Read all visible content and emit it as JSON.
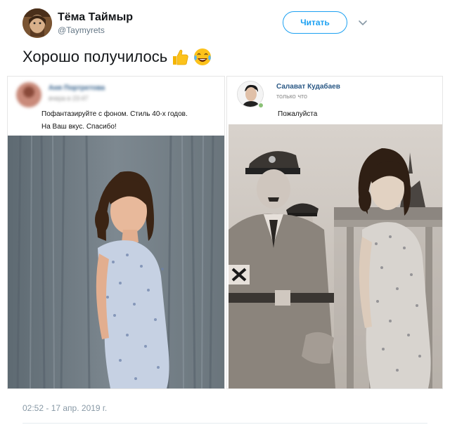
{
  "tweet": {
    "author_name": "Тёма Таймыр",
    "author_handle": "@Taymyrets",
    "follow_label": "Читать",
    "text": "Хорошо получилось",
    "emojis": [
      "thumbs-up-icon",
      "tears-of-joy-icon"
    ],
    "timestamp": "02:52 - 17 апр. 2019 г."
  },
  "left_card": {
    "sender_name": "Аня Портретова",
    "sender_time": "вчера в 23:47",
    "message_lines": [
      "Пофантазируйте с фоном. Стиль 40-х годов.",
      "На Ваш вкус. Спасибо!"
    ]
  },
  "right_card": {
    "sender_name": "Салават Кудабаев",
    "sender_time": "только что",
    "message": "Пожалуйста"
  },
  "colors": {
    "accent": "#1da1f2",
    "link_name": "#2a5885",
    "muted": "#657786"
  }
}
